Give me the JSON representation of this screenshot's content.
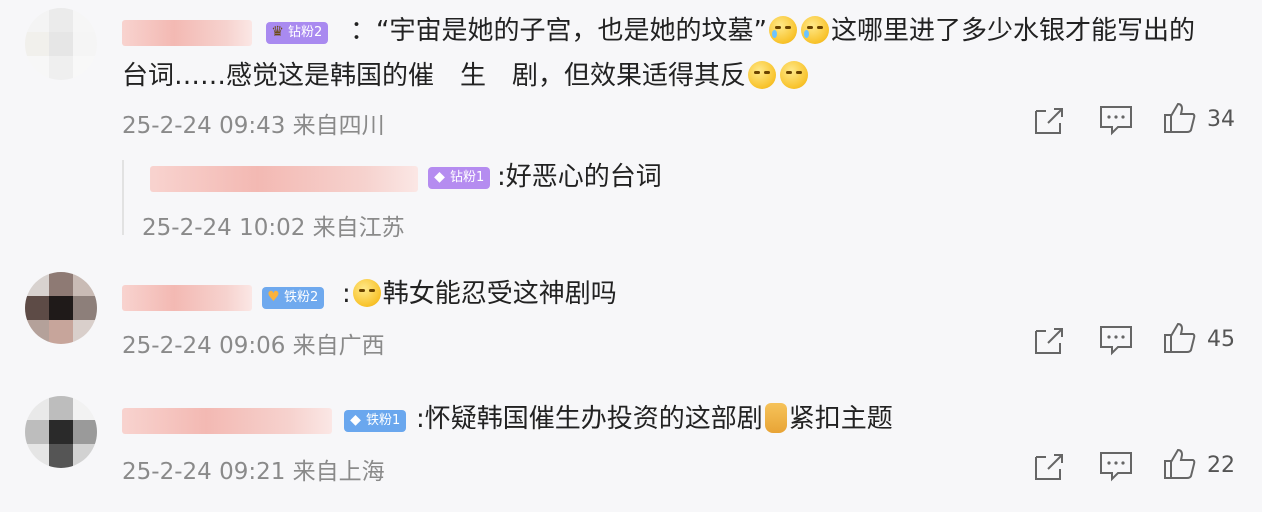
{
  "comments": [
    {
      "badge": "钻粉2",
      "text_line1_a": "：“宇宙是她的子宫，也是她的坟墓”",
      "text_line1_b": "这哪里进了多少水银才能写出的",
      "text_line2_a": "台词……感觉这是韩国的催　生　剧，但效果适得其反",
      "meta": "25-2-24 09:43 来自四川",
      "likes": "34",
      "emoji_1": "crying-face-emoji",
      "emoji_2": "laughing-crying-face-emoji"
    },
    {
      "badge": "钻粉1",
      "text": ":好恶心的台词",
      "meta": "25-2-24 10:02 来自江苏"
    },
    {
      "badge": "铁粉2",
      "text": "韩女能忍受这神剧吗",
      "prefix": ":",
      "meta": "25-2-24 09:06 来自广西",
      "likes": "45",
      "emoji_1": "sad-face-emoji"
    },
    {
      "badge": "铁粉1",
      "text_a": ":怀疑韩国催生办投资的这部剧",
      "text_b": "紧扣主题",
      "meta": "25-2-24 09:21 来自上海",
      "likes": "22",
      "emoji_1": "thumbs-up-emoji"
    }
  ],
  "icons": {
    "share": "share-icon",
    "comment": "comment-icon",
    "like": "thumbs-up-icon"
  },
  "colors": {
    "badge_purple": "#b07cf0",
    "badge_blue": "#6fa9ee",
    "meta_gray": "#8a8a8a"
  }
}
